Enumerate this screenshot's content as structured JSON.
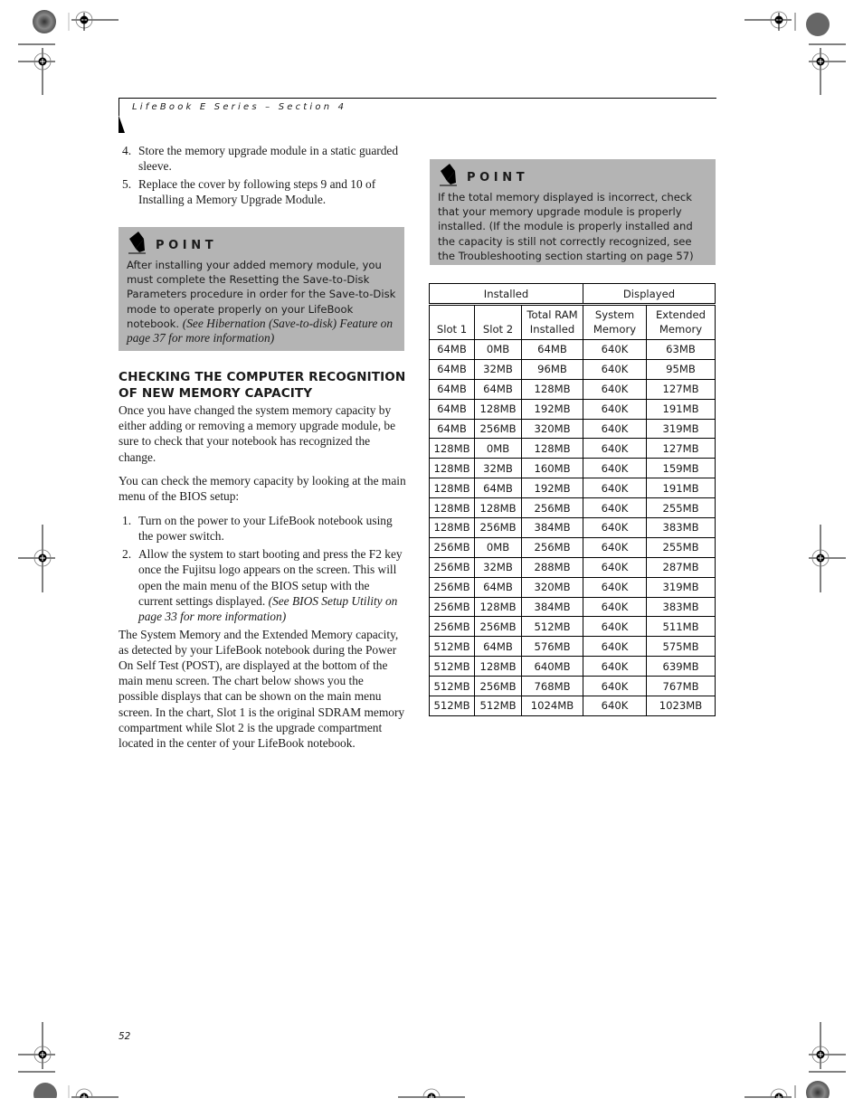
{
  "header": {
    "title": "LifeBook E Series – Section 4"
  },
  "left_column": {
    "steps_top": [
      {
        "num": "4.",
        "text": "Store the memory upgrade module in a static guarded sleeve."
      },
      {
        "num": "5.",
        "text": "Replace the cover by following steps 9 and 10 of Installing a Memory Upgrade Module."
      }
    ],
    "point_box": {
      "title": "POINT",
      "text": "After installing your added memory module, you must complete the Resetting the Save-to-Disk Parameters procedure in order for the Save-to-Disk mode to operate properly on your LifeBook notebook.",
      "italic_ref": "(See Hibernation (Save-to-disk) Feature on page 37 for more information)"
    },
    "section_heading": "CHECKING THE COMPUTER RECOGNITION OF NEW MEMORY CAPACITY",
    "para1": "Once you have changed the system memory capacity by either adding or removing a memory upgrade module, be sure to check that your notebook has recognized the change.",
    "para2": "You can check the memory capacity by looking at the main menu of the BIOS setup:",
    "steps": [
      {
        "num": "1.",
        "text": "Turn on the power to your LifeBook notebook using the power switch.",
        "italic_ref": ""
      },
      {
        "num": "2.",
        "text": "Allow the system to start booting and press the F2 key once the Fujitsu logo appears on the screen. This will open the main menu of the BIOS setup with the current settings displayed.",
        "italic_ref": "(See BIOS Setup Utility on page 33 for more information)"
      }
    ],
    "para3": "The System Memory and the Extended Memory capacity, as detected by your LifeBook notebook during the Power On Self Test (POST), are displayed at the bottom of the main menu screen. The chart below shows you the possible displays that can be shown on the main menu screen. In the chart, Slot 1 is the original SDRAM memory compartment while Slot 2 is the upgrade compartment located in the center of your LifeBook notebook."
  },
  "right_column": {
    "point_box": {
      "title": "POINT",
      "text": "If the total memory displayed is incorrect, check that your memory upgrade module is properly installed. (If the module is properly installed and the capacity is still not correctly recognized, see the Troubleshooting section starting on page 57)"
    },
    "table": {
      "groups": [
        "Installed",
        "Displayed"
      ],
      "columns": [
        "Slot 1",
        "Slot 2",
        "Total RAM Installed",
        "System Memory",
        "Extended Memory"
      ],
      "rows": [
        [
          "64MB",
          "0MB",
          "64MB",
          "640K",
          "63MB"
        ],
        [
          "64MB",
          "32MB",
          "96MB",
          "640K",
          "95MB"
        ],
        [
          "64MB",
          "64MB",
          "128MB",
          "640K",
          "127MB"
        ],
        [
          "64MB",
          "128MB",
          "192MB",
          "640K",
          "191MB"
        ],
        [
          "64MB",
          "256MB",
          "320MB",
          "640K",
          "319MB"
        ],
        [
          "128MB",
          "0MB",
          "128MB",
          "640K",
          "127MB"
        ],
        [
          "128MB",
          "32MB",
          "160MB",
          "640K",
          "159MB"
        ],
        [
          "128MB",
          "64MB",
          "192MB",
          "640K",
          "191MB"
        ],
        [
          "128MB",
          "128MB",
          "256MB",
          "640K",
          "255MB"
        ],
        [
          "128MB",
          "256MB",
          "384MB",
          "640K",
          "383MB"
        ],
        [
          "256MB",
          "0MB",
          "256MB",
          "640K",
          "255MB"
        ],
        [
          "256MB",
          "32MB",
          "288MB",
          "640K",
          "287MB"
        ],
        [
          "256MB",
          "64MB",
          "320MB",
          "640K",
          "319MB"
        ],
        [
          "256MB",
          "128MB",
          "384MB",
          "640K",
          "383MB"
        ],
        [
          "256MB",
          "256MB",
          "512MB",
          "640K",
          "511MB"
        ],
        [
          "512MB",
          "64MB",
          "576MB",
          "640K",
          "575MB"
        ],
        [
          "512MB",
          "128MB",
          "640MB",
          "640K",
          "639MB"
        ],
        [
          "512MB",
          "256MB",
          "768MB",
          "640K",
          "767MB"
        ],
        [
          "512MB",
          "512MB",
          "1024MB",
          "640K",
          "1023MB"
        ]
      ]
    }
  },
  "footer": {
    "page_number": "52"
  }
}
